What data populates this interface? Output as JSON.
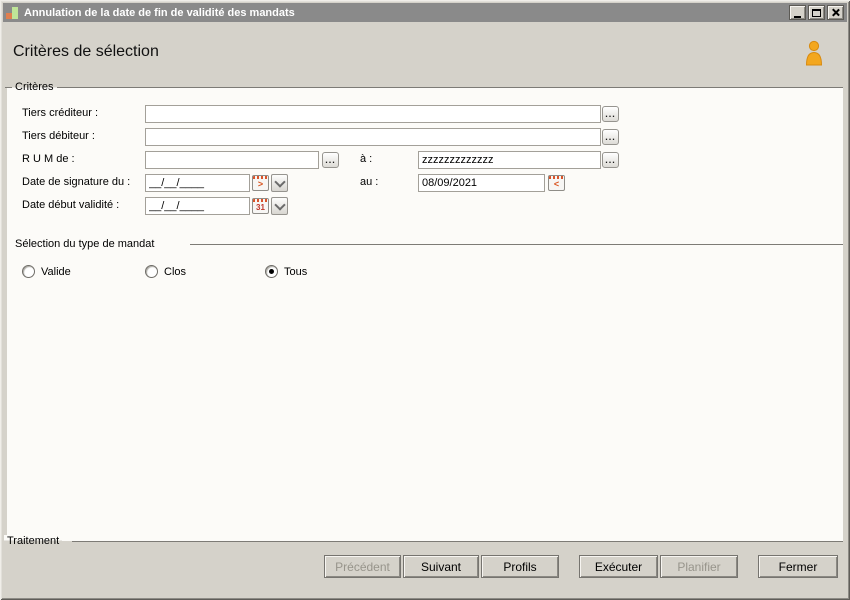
{
  "window": {
    "title": "Annulation de la date de fin de validité des mandats"
  },
  "header": {
    "title": "Critères de sélection"
  },
  "criteria": {
    "legend": "Critères",
    "tiers_crediteur": {
      "label": "Tiers créditeur :",
      "value": ""
    },
    "tiers_debiteur": {
      "label": "Tiers débiteur :",
      "value": ""
    },
    "rum": {
      "label": "R U M de :",
      "value": "",
      "to_label": "à :",
      "to_value": "zzzzzzzzzzzzz"
    },
    "date_signature": {
      "label": "Date de signature du :",
      "value": "__/__/____",
      "to_label": "au :",
      "to_value": "08/09/2021"
    },
    "date_debut": {
      "label": "Date début validité :",
      "value": "__/__/____"
    }
  },
  "mandat": {
    "legend": "Sélection du type de mandat",
    "options": [
      {
        "label": "Valide",
        "selected": false
      },
      {
        "label": "Clos",
        "selected": false
      },
      {
        "label": "Tous",
        "selected": true
      }
    ]
  },
  "traitement": {
    "legend": "Traitement"
  },
  "buttons": [
    {
      "label": "Précédent",
      "enabled": false
    },
    {
      "label": "Suivant",
      "enabled": true
    },
    {
      "label": "Profils",
      "enabled": true
    },
    {
      "label": "Exécuter",
      "enabled": true
    },
    {
      "label": "Planifier",
      "enabled": false
    },
    {
      "label": "Fermer",
      "enabled": true
    }
  ],
  "icons": {
    "ellipsis": "...",
    "calendar_next": ">",
    "calendar_prev": "<",
    "calendar_day": "31",
    "minimize": "_",
    "maximize": "□",
    "close": "✕",
    "user": "person",
    "app": "bar-chart"
  },
  "colors": {
    "titlebar": "#8a8a8a",
    "dialog_bg": "#d5d2ca",
    "panel_bg": "#fcfbf8",
    "accent_orange": "#f0a22a",
    "calendar_red": "#d9542b"
  }
}
